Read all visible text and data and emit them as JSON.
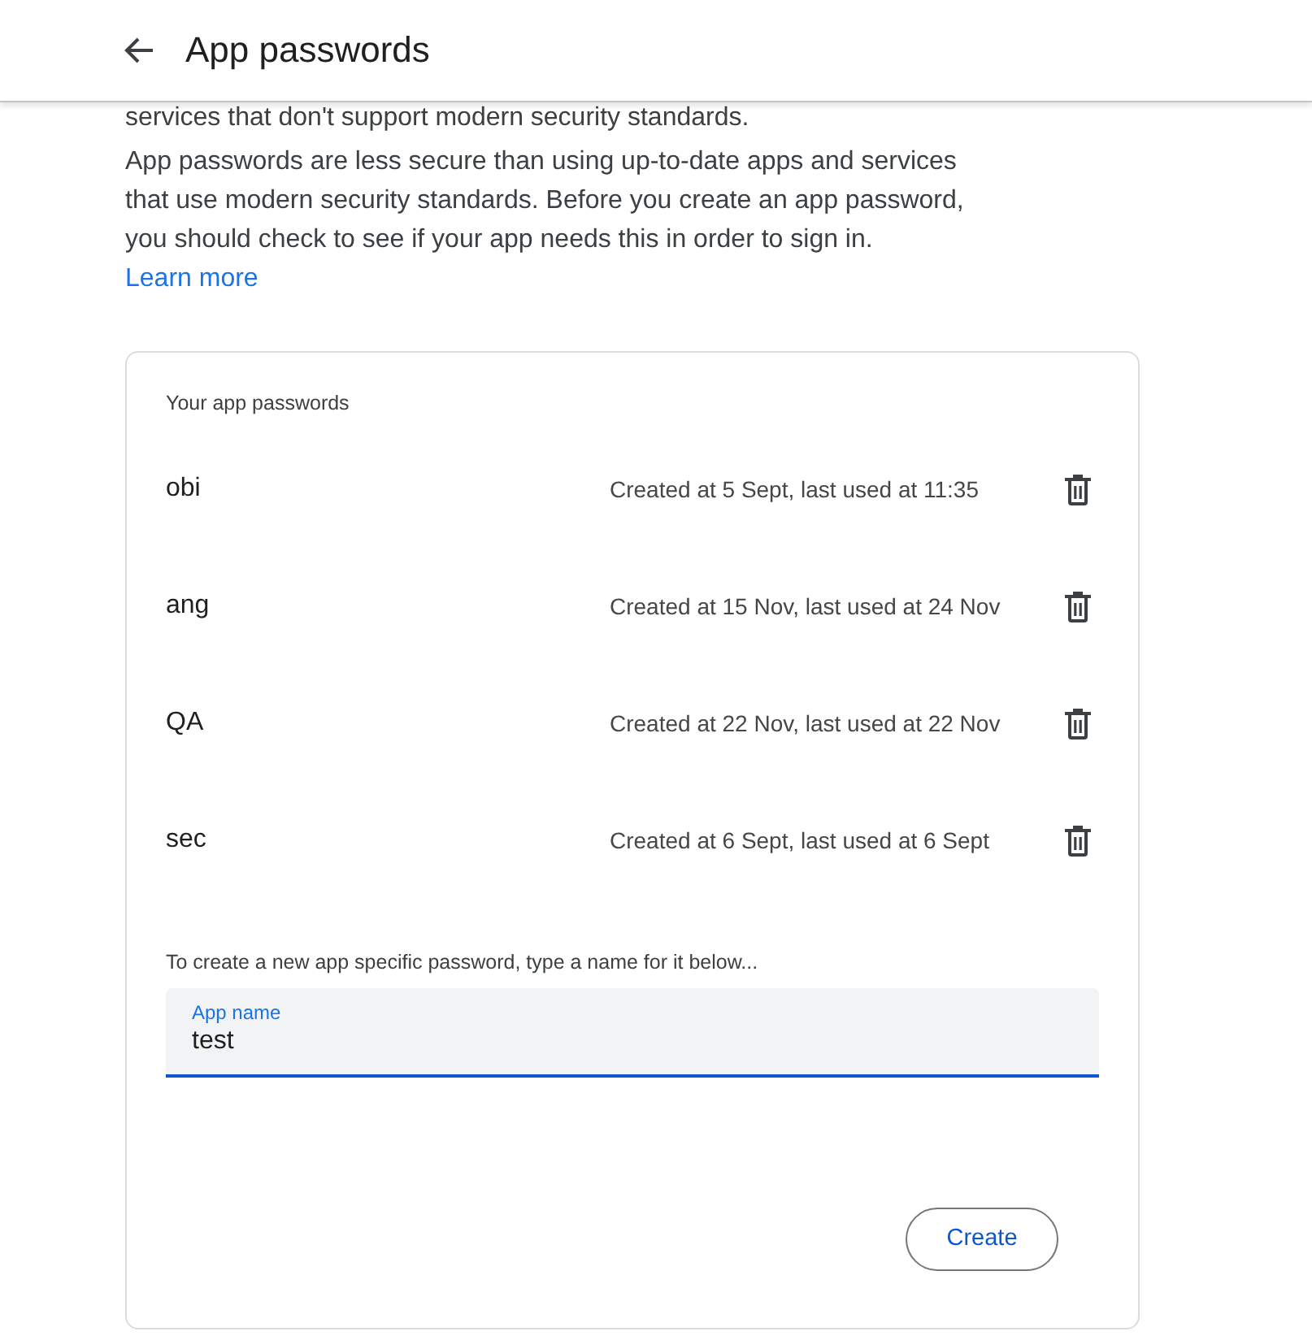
{
  "header": {
    "title": "App passwords"
  },
  "intro_partial": "services that don't support modern security standards.",
  "notice": "App passwords are less secure than using up-to-date apps and services that use modern security standards. Before you create an app password, you should check to see if your app needs this in order to sign in.",
  "learn_more": "Learn more",
  "passwords": {
    "heading": "Your app passwords",
    "items": [
      {
        "name": "obi",
        "details": "Created at 5 Sept, last used at 11:35"
      },
      {
        "name": "ang",
        "details": "Created at 15 Nov, last used at 24 Nov"
      },
      {
        "name": "QA",
        "details": "Created at 22 Nov, last used at 22 Nov"
      },
      {
        "name": "sec",
        "details": "Created at 6 Sept, last used at 6 Sept"
      }
    ]
  },
  "create": {
    "instruction": "To create a new app specific password, type a name for it below...",
    "field": {
      "label": "App name",
      "value": "test"
    },
    "button": "Create"
  }
}
